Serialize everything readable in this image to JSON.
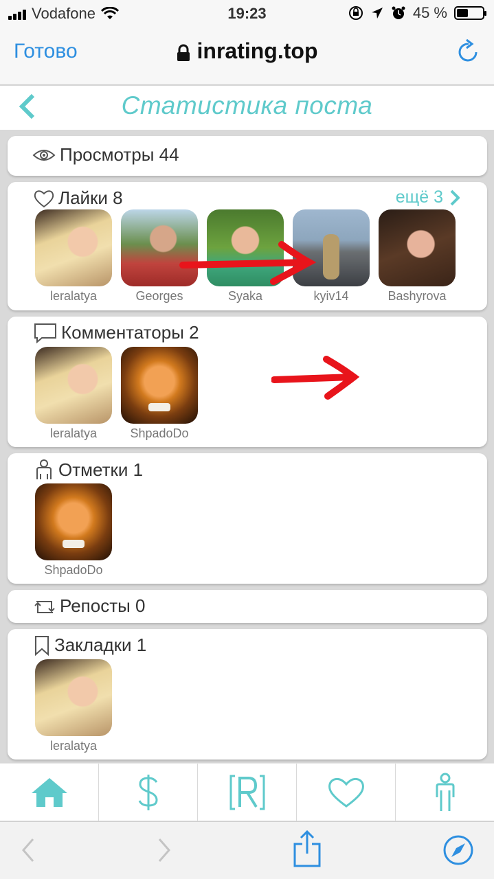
{
  "status": {
    "carrier": "Vodafone",
    "time": "19:23",
    "battery": "45 %",
    "battery_level": 0.45
  },
  "browser": {
    "done_label": "Готово",
    "url": "inrating.top"
  },
  "page": {
    "title": "Статистика поста"
  },
  "views": {
    "label": "Просмотры 44"
  },
  "likes": {
    "label": "Лайки 8",
    "more_label": "ещё 3",
    "users": [
      {
        "name": "leralatya"
      },
      {
        "name": "Georges"
      },
      {
        "name": "Syaka"
      },
      {
        "name": "kyiv14"
      },
      {
        "name": "Bashyrova"
      }
    ]
  },
  "commenters": {
    "label": "Комментаторы 2",
    "users": [
      {
        "name": "leralatya"
      },
      {
        "name": "ShpadoDo"
      }
    ]
  },
  "tags": {
    "label": "Отметки 1",
    "users": [
      {
        "name": "ShpadoDo"
      }
    ]
  },
  "reposts": {
    "label": "Репосты 0"
  },
  "bookmarks": {
    "label": "Закладки 1",
    "users": [
      {
        "name": "leralatya"
      }
    ]
  },
  "icons": {
    "accent": "#5fcacb",
    "link": "#2e8fe0",
    "annotation": "#e8141b"
  }
}
